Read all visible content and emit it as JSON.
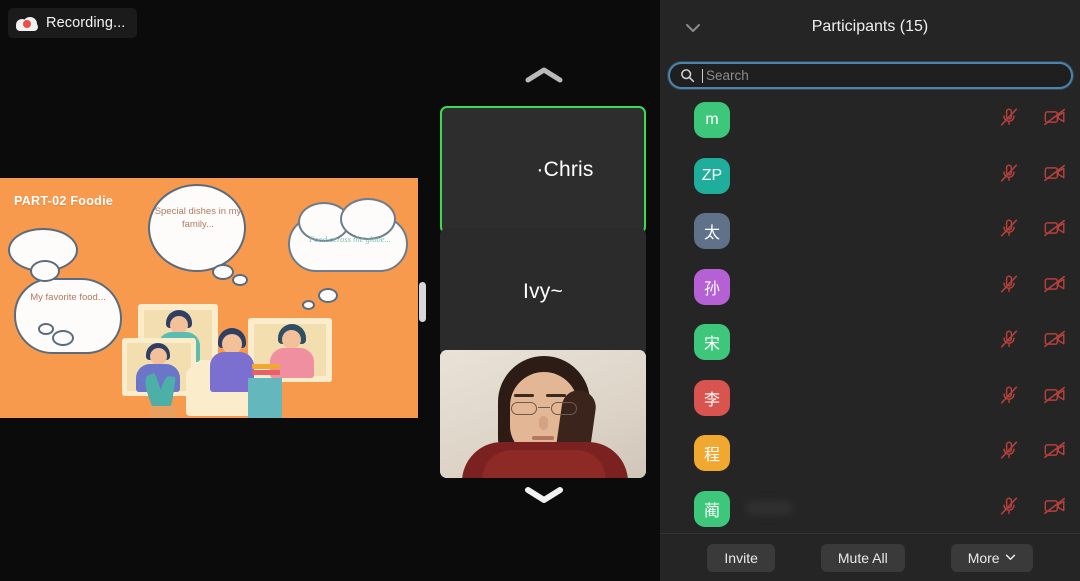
{
  "recording": {
    "label": "Recording...",
    "icon": "cloud-record-icon",
    "dot_color": "#e8514a"
  },
  "share": {
    "slide_title": "PART-02 Foodie",
    "background_color": "#f79a4e",
    "bubbles": [
      {
        "text": "My favorite food...",
        "position": "left"
      },
      {
        "text": "Special dishes in my family...",
        "position": "center"
      },
      {
        "text": "Food across the globe...",
        "position": "right"
      }
    ]
  },
  "filmstrip": {
    "scroll_up_icon": "chevron-up-icon",
    "scroll_down_icon": "chevron-down-icon",
    "tiles": [
      {
        "name": "·Chris",
        "active_speaker": true,
        "border_color": "#3ddb52",
        "video_on": false
      },
      {
        "name": "Ivy~",
        "active_speaker": false,
        "video_on": false
      },
      {
        "name": "",
        "active_speaker": false,
        "video_on": true
      }
    ]
  },
  "panel": {
    "title": "Participants (15)",
    "count": 15,
    "collapse_icon": "chevron-down-icon",
    "search": {
      "placeholder": "Search",
      "value": "",
      "icon": "search-icon",
      "focused": true,
      "border_color": "#4b84ad"
    },
    "participants": [
      {
        "initial": "m",
        "color": "#3ec77a",
        "name": "",
        "muted": true,
        "video_off": true
      },
      {
        "initial": "ZP",
        "color": "#1fae9b",
        "name": "",
        "muted": true,
        "video_off": true
      },
      {
        "initial": "太",
        "color": "#60728a",
        "name": "",
        "muted": true,
        "video_off": true
      },
      {
        "initial": "孙",
        "color": "#b560d4",
        "name": "",
        "muted": true,
        "video_off": true
      },
      {
        "initial": "宋",
        "color": "#3ec77a",
        "name": "",
        "muted": true,
        "video_off": true
      },
      {
        "initial": "李",
        "color": "#d9534f",
        "name": "",
        "muted": true,
        "video_off": true
      },
      {
        "initial": "程",
        "color": "#f0a830",
        "name": "",
        "muted": true,
        "video_off": true
      },
      {
        "initial": "蔺",
        "color": "#3ec77a",
        "name": "",
        "muted": true,
        "video_off": true
      }
    ],
    "mute_icon": "mic-muted-icon",
    "video_icon": "video-off-icon",
    "icon_color": "#b5403c",
    "footer": {
      "invite_label": "Invite",
      "mute_all_label": "Mute All",
      "more_label": "More",
      "more_icon": "chevron-down-icon"
    }
  }
}
